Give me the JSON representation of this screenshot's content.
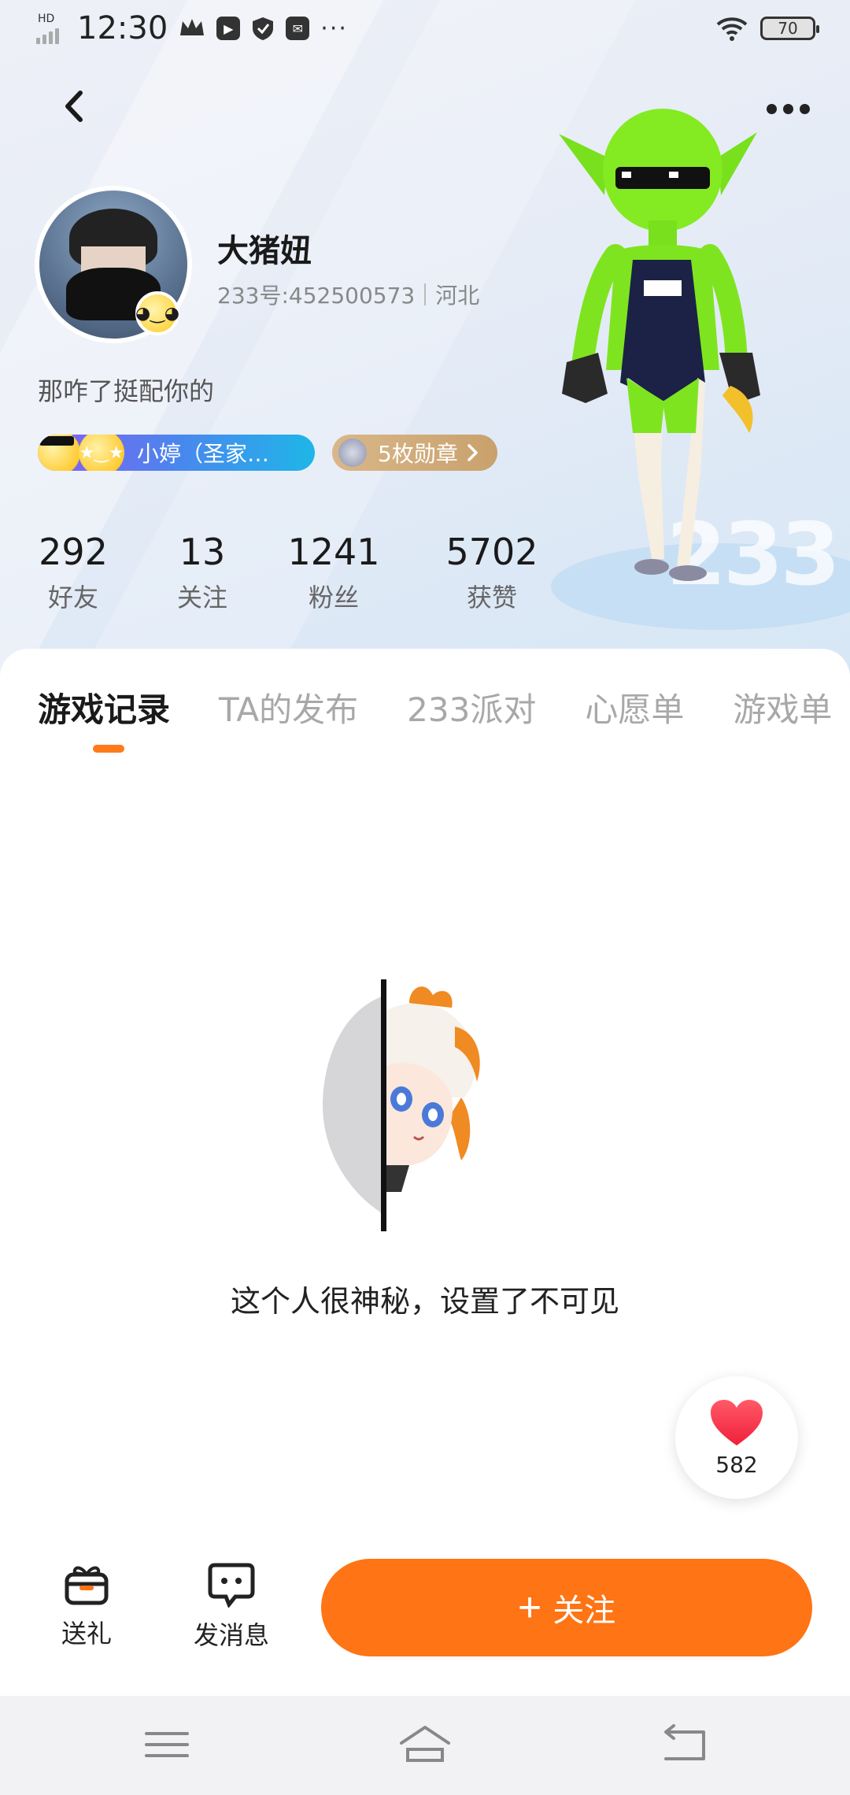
{
  "status_bar": {
    "time": "12:30",
    "hd_label": "HD",
    "battery": "70",
    "more_label": "···"
  },
  "profile": {
    "name": "大猪妞",
    "id_label": "233号:452500573",
    "region": "河北",
    "bio": "那咋了挺配你的",
    "friend_tag": "小婷（圣家…",
    "medal_tag": "5枚勋章"
  },
  "stats": [
    {
      "value": "292",
      "label": "好友"
    },
    {
      "value": "13",
      "label": "关注"
    },
    {
      "value": "1241",
      "label": "粉丝"
    },
    {
      "value": "5702",
      "label": "获赞"
    }
  ],
  "background_text": "233",
  "tabs": [
    "游戏记录",
    "TA的发布",
    "233派对",
    "心愿单",
    "游戏单"
  ],
  "active_tab": "游戏记录",
  "empty_state": {
    "text": "这个人很神秘，设置了不可见"
  },
  "like": {
    "count": "582"
  },
  "actions": {
    "gift": "送礼",
    "message": "发消息",
    "follow": "关注",
    "follow_plus": "+"
  },
  "colors": {
    "accent": "#ff7414",
    "tab_indicator": "#ff7a1a",
    "friend_tag_gradient": [
      "#8a5cf0",
      "#1fb6e8"
    ],
    "medal_tag": "#c9a16c",
    "like_heart": "#ff3b4e"
  },
  "icons": {
    "back": "chevron-left-icon",
    "more": "more-dots-icon",
    "gift": "gift-icon",
    "message": "chat-bubble-icon",
    "like": "heart-icon",
    "sys_menu": "menu-lines-icon",
    "sys_home": "home-icon",
    "sys_back": "return-icon"
  }
}
